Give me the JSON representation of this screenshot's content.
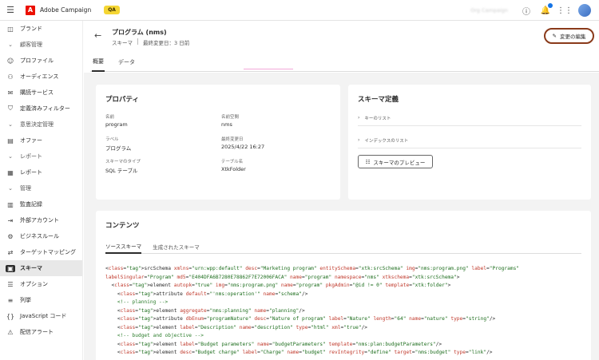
{
  "app": {
    "name": "Adobe Campaign",
    "env_badge": "QA",
    "org_name": "Org Campaign",
    "icons": [
      "help-icon",
      "bell-icon",
      "apps-grid-icon",
      "user-avatar"
    ]
  },
  "sidebar": {
    "items": [
      {
        "type": "item",
        "label": "ブランド",
        "icon": "brand-icon"
      },
      {
        "type": "section",
        "label": "顧客管理"
      },
      {
        "type": "item",
        "label": "プロファイル",
        "icon": "profile-icon"
      },
      {
        "type": "item",
        "label": "オーディエンス",
        "icon": "audience-icon"
      },
      {
        "type": "item",
        "label": "購読サービス",
        "icon": "subscription-icon"
      },
      {
        "type": "item",
        "label": "定義済みフィルター",
        "icon": "filter-icon"
      },
      {
        "type": "section",
        "label": "意思決定管理"
      },
      {
        "type": "item",
        "label": "オファー",
        "icon": "offer-icon"
      },
      {
        "type": "section",
        "label": "レポート"
      },
      {
        "type": "item",
        "label": "レポート",
        "icon": "report-icon"
      },
      {
        "type": "section",
        "label": "管理"
      },
      {
        "type": "item",
        "label": "監査記録",
        "icon": "audit-icon"
      },
      {
        "type": "item",
        "label": "外部アカウント",
        "icon": "external-account-icon"
      },
      {
        "type": "item",
        "label": "ビジネスルール",
        "icon": "business-rule-icon"
      },
      {
        "type": "item",
        "label": "ターゲットマッピング",
        "icon": "target-mapping-icon"
      },
      {
        "type": "item",
        "label": "スキーマ",
        "icon": "schema-icon",
        "active": true
      },
      {
        "type": "item",
        "label": "オプション",
        "icon": "options-icon"
      },
      {
        "type": "item",
        "label": "列挙",
        "icon": "enum-icon"
      },
      {
        "type": "item",
        "label": "JavaScript コード",
        "icon": "js-icon"
      },
      {
        "type": "item",
        "label": "配信アラート",
        "icon": "alert-icon"
      }
    ]
  },
  "header": {
    "title": "プログラム (nms)",
    "subtitle_type": "スキーマ",
    "subtitle_modified": "最終変更日：3 日前",
    "edit_label": "変更の編集"
  },
  "tabs": [
    "概要",
    "データ"
  ],
  "properties": {
    "title": "プロパティ",
    "fields": [
      {
        "label": "名前",
        "value": "program"
      },
      {
        "label": "名前空間",
        "value": "nms"
      },
      {
        "label": "ラベル",
        "value": "プログラム"
      },
      {
        "label": "最終変更日",
        "value": "2025/4/22 16:27"
      },
      {
        "label": "スキーマのタイプ",
        "value": "SQL テーブル"
      },
      {
        "label": "テーブル名",
        "value": "XtkFolder"
      }
    ]
  },
  "schema_def": {
    "title": "スキーマ定義",
    "rows": [
      "キーのリスト",
      "インデックスのリスト"
    ],
    "preview_label": "スキーマのプレビュー"
  },
  "contents": {
    "title": "コンテンツ",
    "tabs": [
      "ソーススキーマ",
      "生成されたスキーマ"
    ],
    "code_lines": [
      "<srcSchema xmlns=\"urn:wpp:default\" desc=\"Marketing program\" entitySchema=\"xtk:srcSchema\" img=\"nms:program.png\" label=\"Programs\"",
      "labelSingular=\"Program\" md5=\"E404DFA6B7280E78862F7E72006FACA\" name=\"program\" namespace=\"nms\" xtkschema=\"xtk:srcSchema\">",
      "  <element autopk=\"true\" img=\"nms:program.png\" name=\"program\" pkgAdmin=\"@id != 0\" template=\"xtk:folder\">",
      "    <attribute default=\"'nms:operation'\" name=\"schema\"/>",
      "    <!-- planning -->",
      "    <element aggregate=\"nms:planning\" name=\"planning\"/>",
      "    <attribute dbEnum=\"programNature\" desc=\"Nature of program\" label=\"Nature\" length=\"64\" name=\"nature\" type=\"string\"/>",
      "    <element label=\"Description\" name=\"description\" type=\"html\" xml=\"true\"/>",
      "    <!-- budget and objective -->",
      "    <element label=\"Budget parameters\" name=\"budgetParameters\" template=\"nms:plan:budgetParameters\"/>",
      "    <element desc=\"Budget charge\" label=\"Charge\" name=\"budget\" revIntegrity=\"define\" target=\"nms:budget\" type=\"link\"/>"
    ]
  }
}
